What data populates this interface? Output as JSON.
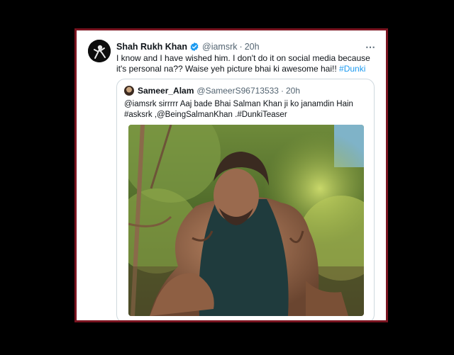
{
  "tweet": {
    "author_name": "Shah Rukh Khan",
    "handle": "@iamsrk",
    "time": "20h",
    "text_lead": "I know and I have wished him. I don't do it on social media because it's personal na?? Waise yeh picture bhai ki awesome hai!! ",
    "hashtag": "#Dunki",
    "more_icon": "⋯",
    "verified_icon": "verified-badge-icon"
  },
  "quote": {
    "author_name": "Sameer_Alam",
    "handle": "@SameerS96713533",
    "time": "20h",
    "text_line1": "@iamsrk sirrrrr Aaj bade Bhai Salman Khan ji ko janamdin Hain",
    "text_line2": "#asksrk ,@BeingSalmanKhan .#DunkiTeaser"
  },
  "colors": {
    "frame_border": "#7a1420",
    "link": "#1d9bf0",
    "muted": "#536471",
    "verified": "#1d9bf0"
  }
}
